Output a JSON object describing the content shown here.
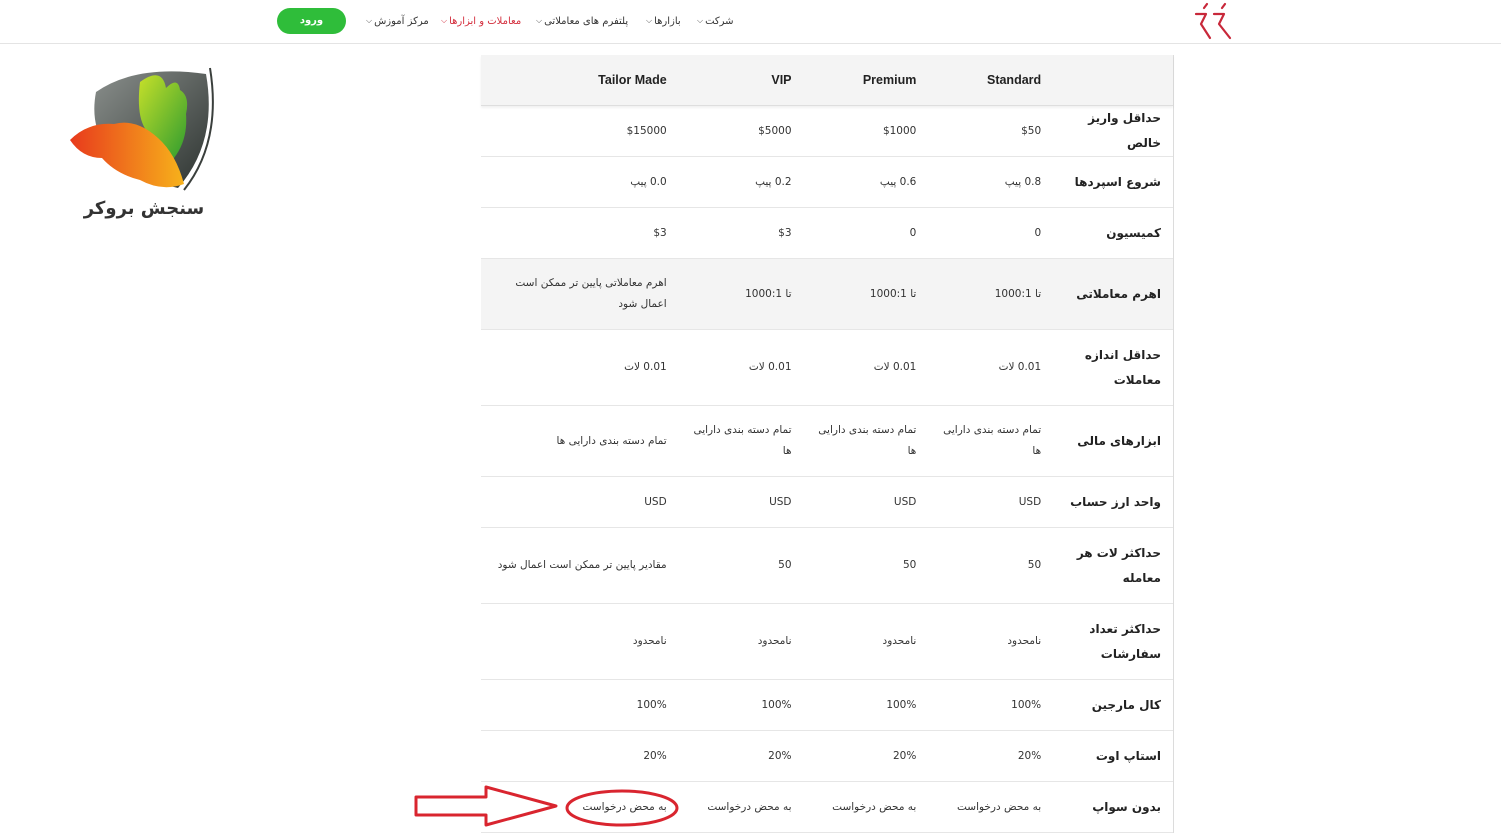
{
  "header": {
    "login_label": "ورود",
    "nav": [
      {
        "label": "شرکت",
        "active": false
      },
      {
        "label": "بازارها",
        "active": false
      },
      {
        "label": "پلتفرم های معاملاتی",
        "active": false
      },
      {
        "label": "معاملات و ابزارها",
        "active": true
      },
      {
        "label": "مرکز آموزش",
        "active": false
      }
    ],
    "accent_color": "#d32d3c",
    "login_color": "#2fbd3a"
  },
  "watermark": {
    "brand_text": "سنجش بروکر"
  },
  "table": {
    "columns": [
      "",
      "Standard",
      "Premium",
      "VIP",
      "Tailor Made"
    ],
    "rows": [
      {
        "label": "حداقل واریز خالص",
        "values": [
          "$50",
          "$1000",
          "$5000",
          "$15000"
        ]
      },
      {
        "label": "شروع اسپردها",
        "values": [
          "0.8 پیپ",
          "0.6 پیپ",
          "0.2 پیپ",
          "0.0 پیپ"
        ]
      },
      {
        "label": "کمیسیون",
        "values": [
          "0",
          "0",
          "$3",
          "$3"
        ]
      },
      {
        "label": "اهرم معاملاتی",
        "values": [
          "تا 1000:1",
          "تا 1000:1",
          "تا 1000:1",
          "اهرم معاملاتی پایین تر ممکن است اعمال شود"
        ]
      },
      {
        "label": "حداقل اندازه معاملات",
        "values": [
          "0.01 لات",
          "0.01 لات",
          "0.01 لات",
          "0.01 لات"
        ]
      },
      {
        "label": "ابزارهای مالی",
        "values": [
          "تمام دسته بندی دارایی ها",
          "تمام دسته بندی دارایی ها",
          "تمام دسته بندی دارایی ها",
          "تمام دسته بندی دارایی ها"
        ]
      },
      {
        "label": "واحد ارز حساب",
        "values": [
          "USD",
          "USD",
          "USD",
          "USD"
        ]
      },
      {
        "label": "حداکثر لات هر معامله",
        "values": [
          "50",
          "50",
          "50",
          "مقادیر پایین تر ممکن است اعمال شود"
        ]
      },
      {
        "label": "حداکثر تعداد سفارشات",
        "values": [
          "نامحدود",
          "نامحدود",
          "نامحدود",
          "نامحدود"
        ]
      },
      {
        "label": "کال مارجین",
        "values": [
          "100%",
          "100%",
          "100%",
          "100%"
        ]
      },
      {
        "label": "استاپ اوت",
        "values": [
          "20%",
          "20%",
          "20%",
          "20%"
        ]
      },
      {
        "label": "بدون سواپ",
        "values": [
          "به محض درخواست",
          "به محض درخواست",
          "به محض درخواست",
          "به محض درخواست"
        ]
      }
    ]
  },
  "annotation_color": "#d9252f"
}
